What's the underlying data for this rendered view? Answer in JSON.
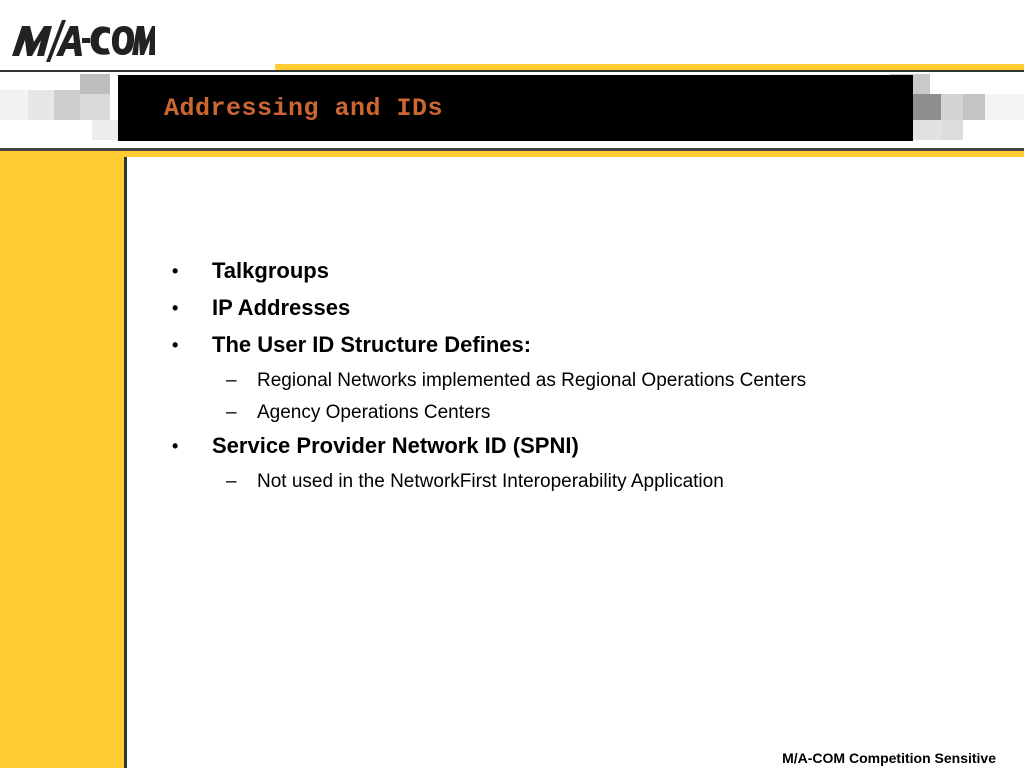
{
  "logo": {
    "text": "M/A-COM"
  },
  "title": "Addressing and IDs",
  "bullets": [
    {
      "label": "Talkgroups",
      "sub": []
    },
    {
      "label": "IP Addresses",
      "sub": []
    },
    {
      "label": "The User ID Structure Defines:",
      "sub": [
        "Regional Networks implemented as Regional Operations Centers",
        "Agency Operations Centers"
      ]
    },
    {
      "label": "Service Provider Network ID (SPNI)",
      "sub": [
        "Not used in the NetworkFirst Interoperability Application"
      ]
    }
  ],
  "bullet_glyph": "•",
  "dash_glyph": "–",
  "footer": "M/A-COM Competition Sensitive",
  "colors": {
    "accent_yellow": "#ffcc33",
    "title": "#cc6633",
    "banner": "#000000"
  }
}
